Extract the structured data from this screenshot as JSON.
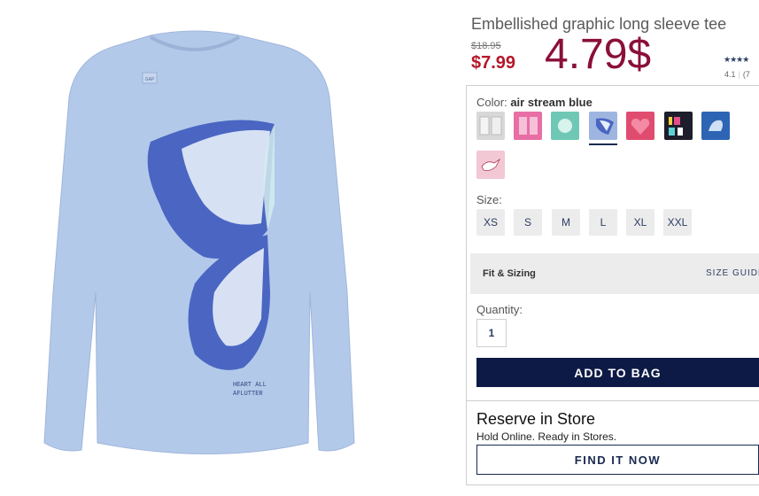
{
  "product": {
    "title": "Embellished graphic long sleeve tee",
    "original_price": "$18.95",
    "sale_price": "$7.99",
    "promo_price": "4.79$",
    "stars": "★★★★",
    "rating": "4.1",
    "review_count": "(7"
  },
  "image": {
    "print_text_line1": "HEART ALL",
    "print_text_line2": "AFLUTTER",
    "tag_text": "GAP",
    "shirt_color": "#b3c9ea"
  },
  "color": {
    "label": "Color:",
    "selected": "air stream blue",
    "swatches": [
      {
        "name": "silver-sequin",
        "color": "#d8d8d8"
      },
      {
        "name": "pink-graphic",
        "color": "#e86ea5"
      },
      {
        "name": "mint-graphic",
        "color": "#6fc8b5"
      },
      {
        "name": "air-stream-blue",
        "color": "#9eb6df"
      },
      {
        "name": "heart-print",
        "color": "#e04c6f"
      },
      {
        "name": "love-dark",
        "color": "#1d1d2b"
      },
      {
        "name": "blue-graphic",
        "color": "#2d65b4"
      },
      {
        "name": "pink-dove",
        "color": "#f2c8d4"
      }
    ]
  },
  "size": {
    "label": "Size:",
    "options": [
      "XS",
      "S",
      "M",
      "L",
      "XL",
      "XXL"
    ]
  },
  "fit": {
    "label": "Fit & Sizing",
    "guide": "SIZE GUIDE"
  },
  "quantity": {
    "label": "Quantity:",
    "value": "1"
  },
  "actions": {
    "add_to_bag": "ADD TO BAG",
    "reserve_title": "Reserve in Store",
    "reserve_sub": "Hold Online. Ready in Stores.",
    "find_it_now": "FIND IT NOW"
  }
}
